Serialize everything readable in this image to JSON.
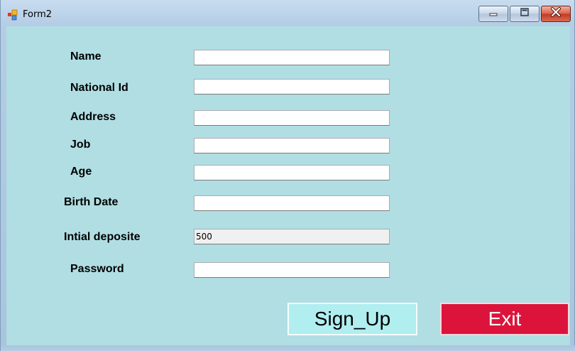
{
  "window": {
    "title": "Form2",
    "controls": {
      "minimize": "minimize",
      "maximize": "maximize",
      "close": "close"
    }
  },
  "form": {
    "fields": [
      {
        "label": "Name",
        "value": ""
      },
      {
        "label": "National Id",
        "value": ""
      },
      {
        "label": "Address",
        "value": ""
      },
      {
        "label": "Job",
        "value": ""
      },
      {
        "label": "Age",
        "value": ""
      },
      {
        "label": "Birth Date",
        "value": ""
      },
      {
        "label": "Intial deposite",
        "value": "500"
      },
      {
        "label": "Password",
        "value": ""
      }
    ]
  },
  "buttons": {
    "signup": "Sign_Up",
    "exit": "Exit"
  },
  "colors": {
    "client_background": "#b0dee3",
    "signup_background": "#b0eef0",
    "exit_background": "#dc143c"
  }
}
